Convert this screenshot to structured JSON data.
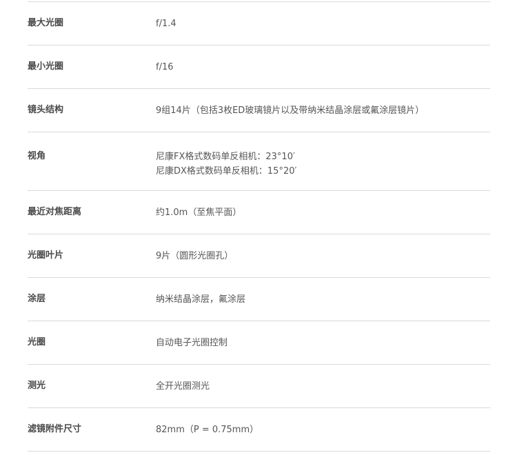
{
  "specs": [
    {
      "label": "最大光圈",
      "value": "f/1.4"
    },
    {
      "label": "最小光圈",
      "value": "f/16"
    },
    {
      "label": "镜头结构",
      "value": "9组14片（包括3枚ED玻璃镜片以及带纳米结晶涂层或氟涂层镜片）"
    },
    {
      "label": "视角",
      "lines": [
        "尼康FX格式数码单反相机：23°10′",
        "尼康DX格式数码单反相机：15°20′"
      ]
    },
    {
      "label": "最近对焦距离",
      "value": "约1.0m（至焦平面）"
    },
    {
      "label": "光圈叶片",
      "value": "9片（圆形光圈孔）"
    },
    {
      "label": "涂层",
      "value": "纳米结晶涂层，氟涂层"
    },
    {
      "label": "光圈",
      "value": "自动电子光圈控制"
    },
    {
      "label": "测光",
      "value": "全开光圈测光"
    },
    {
      "label": "滤镜附件尺寸",
      "value": "82mm（P = 0.75mm）"
    }
  ]
}
